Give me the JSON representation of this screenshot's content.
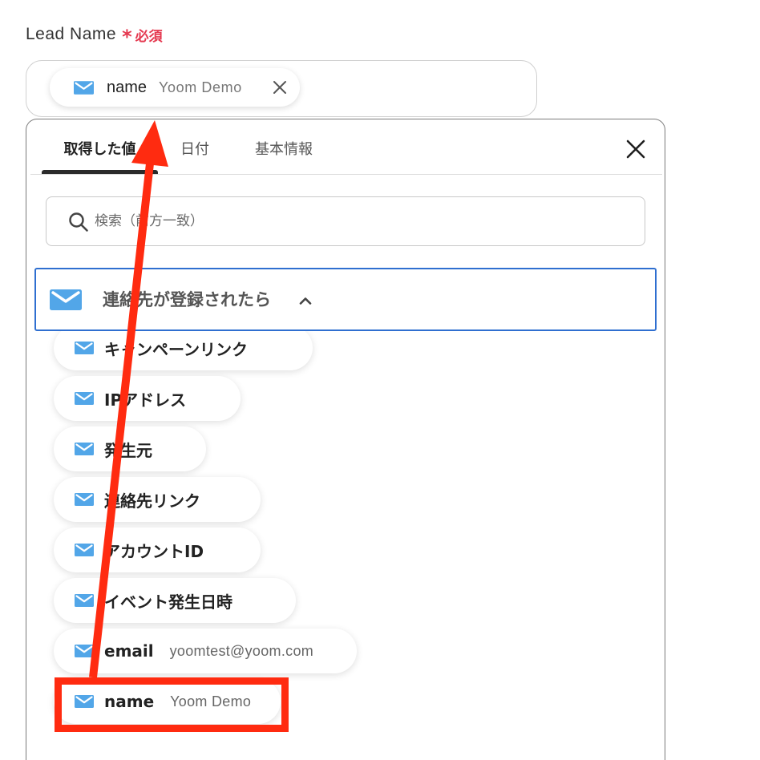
{
  "field": {
    "label": "Lead Name",
    "required_mark": "*",
    "required_text": "必須"
  },
  "selected_chip": {
    "icon": "envelope-icon",
    "name": "name",
    "value": "Yoom Demo",
    "remove_icon": "close-icon"
  },
  "panel": {
    "tabs": [
      {
        "label": "取得した値"
      },
      {
        "label": "日付"
      },
      {
        "label": "基本情報"
      }
    ],
    "active_tab": 0,
    "close_icon": "close-icon",
    "search": {
      "icon": "search-icon",
      "placeholder": "検索（前方一致）"
    },
    "section": {
      "icon": "envelope-icon",
      "title": "連絡先が登録されたら",
      "expanded": true,
      "toggle_icon": "chevron-up-icon"
    },
    "items": [
      {
        "icon": "envelope-icon",
        "label": "キャンペーンリンク"
      },
      {
        "icon": "envelope-icon",
        "label": "IPアドレス"
      },
      {
        "icon": "envelope-icon",
        "label": "発生元"
      },
      {
        "icon": "envelope-icon",
        "label": "連絡先リンク"
      },
      {
        "icon": "envelope-icon",
        "label": "アカウントID"
      },
      {
        "icon": "envelope-icon",
        "label": "イベント発生日時"
      },
      {
        "icon": "envelope-icon",
        "label": "email",
        "value": "yoomtest@yoom.com"
      },
      {
        "icon": "envelope-icon",
        "label": "name",
        "value": "Yoom Demo"
      }
    ]
  },
  "colors": {
    "accent_border": "#2f6fd0",
    "required": "#e53950",
    "icon_blue": "#52a6e8",
    "annotation_red": "#ff2b10"
  }
}
